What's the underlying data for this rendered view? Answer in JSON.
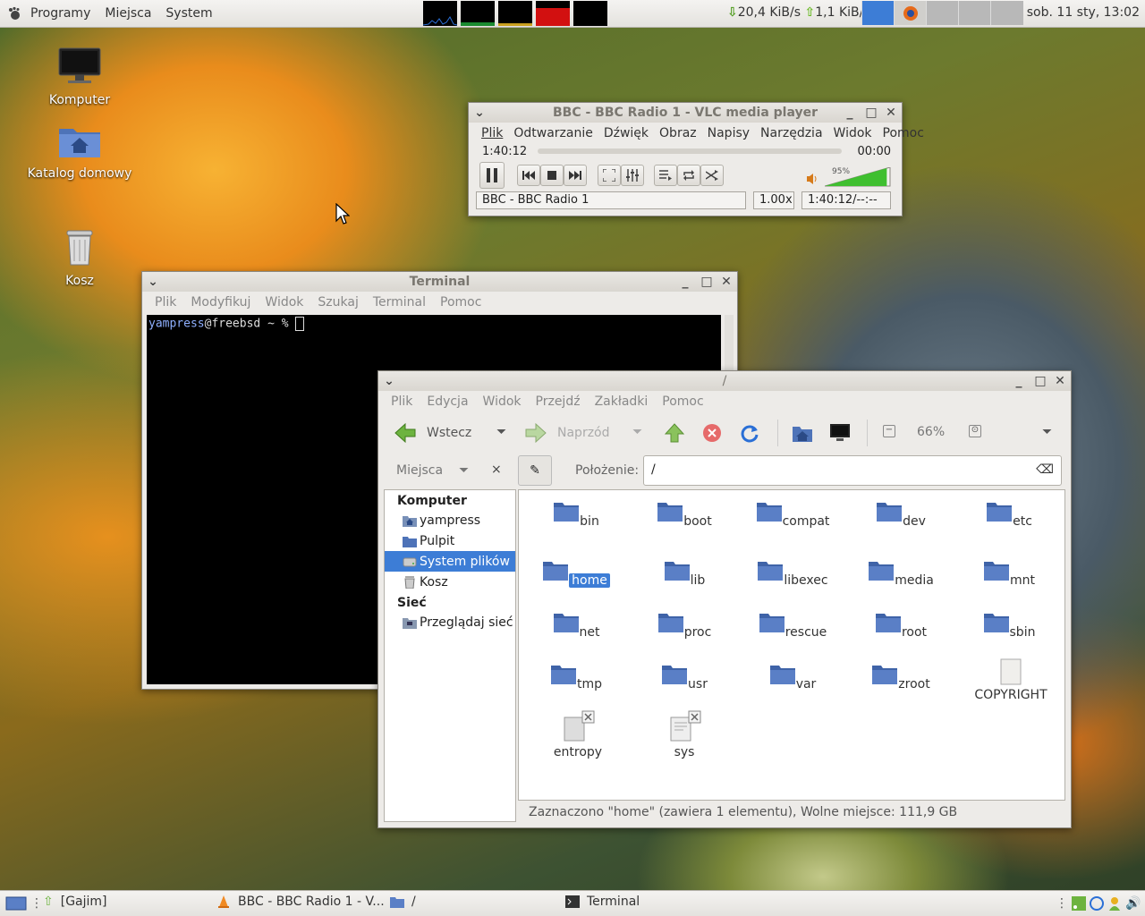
{
  "top_panel": {
    "menus": [
      "Programy",
      "Miejsca",
      "System"
    ],
    "net_down": "20,4 KiB/s",
    "net_up": "1,1 KiB/s",
    "clock": "sob. 11 sty, 13:02"
  },
  "desktop_icons": [
    {
      "label": "Komputer",
      "icon": "monitor-icon"
    },
    {
      "label": "Katalog domowy",
      "icon": "home-folder-icon"
    },
    {
      "label": "Kosz",
      "icon": "trash-icon"
    }
  ],
  "vlc": {
    "title": "BBC - BBC Radio 1 - VLC media player",
    "menu": [
      "Plik",
      "Odtwarzanie",
      "Dźwięk",
      "Obraz",
      "Napisy",
      "Narzędzia",
      "Widok",
      "Pomoc"
    ],
    "elapsed": "1:40:12",
    "remaining": "00:00",
    "volume_label": "95%",
    "volume_level": 0.95,
    "status_title": "BBC - BBC Radio 1",
    "speed": "1.00x",
    "time_status": "1:40:12/--:--"
  },
  "terminal": {
    "title": "Terminal",
    "menu": [
      "Plik",
      "Modyfikuj",
      "Widok",
      "Szukaj",
      "Terminal",
      "Pomoc"
    ],
    "prompt_user": "yampress",
    "prompt_host": "@freebsd",
    "prompt_rest": " ~ % "
  },
  "file_manager": {
    "title": "/",
    "menu": [
      "Plik",
      "Edycja",
      "Widok",
      "Przejdź",
      "Zakładki",
      "Pomoc"
    ],
    "back_label": "Wstecz",
    "forward_label": "Naprzód",
    "zoom": "66%",
    "places_label": "Miejsca",
    "location_label": "Położenie:",
    "location_value": "/",
    "sidebar": {
      "computer_heading": "Komputer",
      "computer_items": [
        "yampress",
        "Pulpit",
        "System plików",
        "Kosz"
      ],
      "network_heading": "Sieć",
      "network_items": [
        "Przeglądaj sieć"
      ]
    },
    "files": [
      "bin",
      "boot",
      "compat",
      "dev",
      "etc",
      "home",
      "lib",
      "libexec",
      "media",
      "mnt",
      "net",
      "proc",
      "rescue",
      "root",
      "sbin",
      "tmp",
      "usr",
      "var",
      "zroot",
      "COPYRIGHT",
      "entropy",
      "sys"
    ],
    "status": "Zaznaczono \"home\" (zawiera 1 elementu), Wolne miejsce: 111,9 GB"
  },
  "bottom_panel": {
    "tasks": [
      "[Gajim]",
      "BBC - BBC Radio 1 - V...",
      "/",
      "Terminal"
    ]
  },
  "colors": {
    "selection": "#3d7dd6",
    "panel": "#eceae6",
    "folder": "#5a7fc6"
  }
}
